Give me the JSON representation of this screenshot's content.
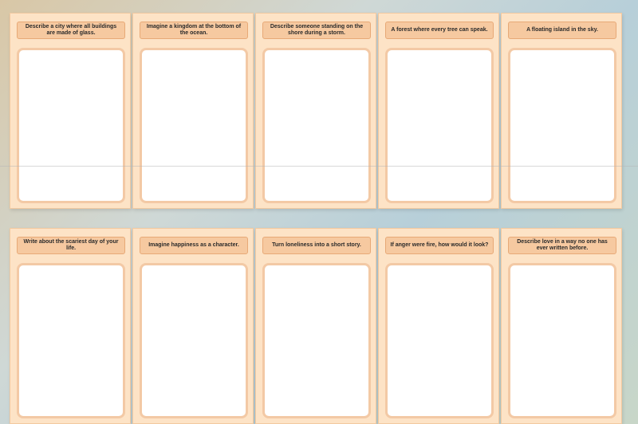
{
  "rows": [
    {
      "prompts": [
        "Describe a city where all buildings are made of glass.",
        "Imagine a kingdom at the bottom of the ocean.",
        "Describe someone standing on the shore during a storm.",
        "A forest where every tree can speak.",
        "A floating island in the sky."
      ]
    },
    {
      "prompts": [
        "Write about the scariest day of your life.",
        "Imagine happiness as a character.",
        "Turn loneliness into a short story.",
        "If anger were fire, how would it look?",
        "Describe love in a way no one has ever written before."
      ]
    }
  ],
  "colors": {
    "card_bg": "#fde3c6",
    "prompt_bg": "#f6c9a0",
    "prompt_border": "#e7a977",
    "box_border": "#f3c9a5"
  }
}
